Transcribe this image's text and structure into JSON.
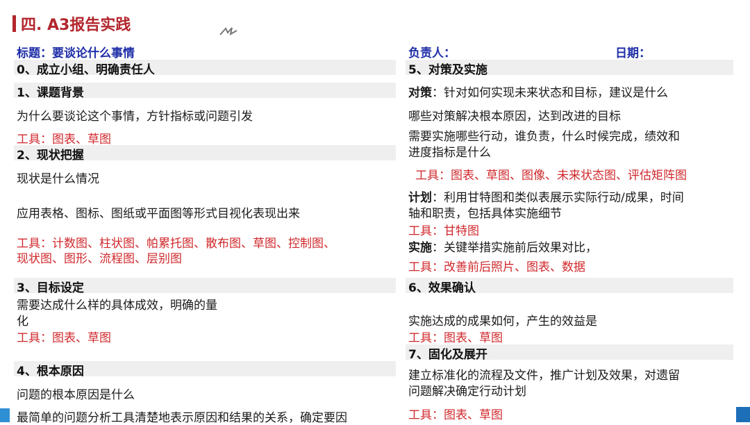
{
  "title": "四. A3报告实践",
  "colors": {
    "accent_red": "#b3262d",
    "label_blue": "#1f2fa8",
    "tool_red": "#d0282c",
    "band_gray": "#efefef"
  },
  "left": {
    "subject_label": "标题：要谈论什么事情",
    "s0": {
      "heading": "0、成立小组、明确责任人"
    },
    "s1": {
      "heading": "1、课题背景",
      "text": "为什么要谈论这个事情，方针指标或问题引发",
      "tools": "工具：图表、草图"
    },
    "s2": {
      "heading": "2、现状把握",
      "text1": "现状是什么情况",
      "text2": "应用表格、图标、图纸或平面图等形式目视化表现出来",
      "tools_line1": "工具：计数图、柱状图、帕累托图、散布图、草图、控制图、",
      "tools_line2": "现状图、图形、流程图、层别图"
    },
    "s3": {
      "heading": "3、目标设定",
      "text_line1": "需要达成什么样的具体成效，明确的量",
      "text_line2": "化",
      "tools": "工具：图表、草图"
    },
    "s4": {
      "heading": "4、根本原因",
      "text1": "问题的根本原因是什么",
      "text2": "最简单的问题分析工具清楚地表示原因和结果的关系，确定要因"
    }
  },
  "right": {
    "owner_label": "负责人：",
    "date_label": "日期：",
    "s5": {
      "heading": "5、对策及实施",
      "measure_label": "对策",
      "measure_text": "：针对如何实现未来状态和目标，建议是什么",
      "text1": "哪些对策解决根本原因，达到改进的目标",
      "text2_line1": "需要实施哪些行动，谁负责，什么时候完成，绩效和",
      "text2_line2": "进度指标是什么",
      "tools": "工具：图表、草图、图像、未来状态图、评估矩阵图",
      "plan_label": "计划",
      "plan_line1": "：利用甘特图和类似表展示实际行动/成果，时间",
      "plan_line2": "轴和职责，包括具体实施细节",
      "plan_tools": "工具：甘特图",
      "impl_label": "实施",
      "impl_text": "：关键举措实施前后效果对比，",
      "impl_tools": "工具：改善前后照片、图表、数据"
    },
    "s6": {
      "heading": "6、效果确认",
      "text": "实施达成的成果如何，产生的效益是",
      "tools": "工具：图表、草图"
    },
    "s7": {
      "heading": "7、固化及展开",
      "text_line1": "建立标准化的流程及文件，推广计划及效果，对遗留",
      "text_line2": "问题解决确定行动计划",
      "tools": "工具：图表、草图"
    }
  }
}
